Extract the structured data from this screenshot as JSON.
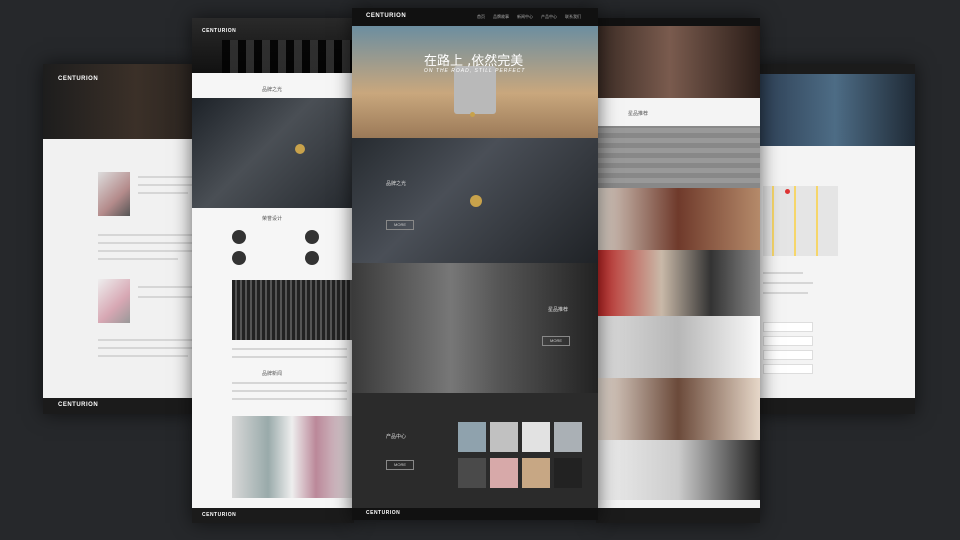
{
  "brand": "CENTURION",
  "center": {
    "hero_title": "在路上 ,依然完美",
    "hero_subtitle": "ON THE ROAD, STILL PERFECT",
    "nav_items": [
      "首页",
      "品牌故事",
      "新闻中心",
      "产品中心",
      "联系我们"
    ],
    "brand_section_title": "品牌之光",
    "product_section_title": "产品中心",
    "star_section_title": "星品推荐",
    "more_button": "MORE"
  },
  "left_page": {
    "intro_title": "品牌之光",
    "design_title": "荣誉设计",
    "brand_news_title": "品牌新闻"
  },
  "right_page": {
    "star_title": "星品推荐"
  },
  "colors": {
    "background": "#26282b",
    "accent": "#c8a24b"
  }
}
